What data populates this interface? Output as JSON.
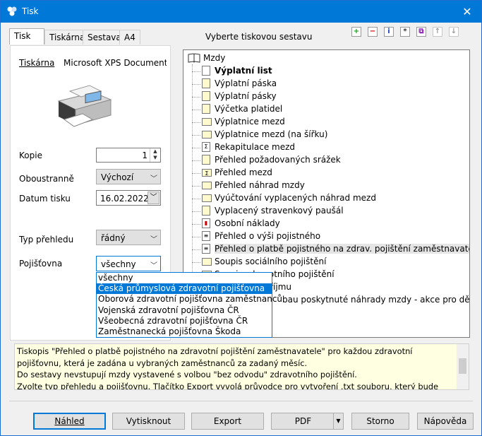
{
  "window": {
    "title": "Tisk",
    "close_icon": "✕"
  },
  "tabs": [
    {
      "label": "Tisk",
      "active": true
    },
    {
      "label": "Tiskárna"
    },
    {
      "label": "Sestava"
    },
    {
      "label": "A4"
    }
  ],
  "left": {
    "printer_label": "Tiskárna",
    "printer_name": "Microsoft XPS Document W",
    "copies_label": "Kopie",
    "copies_value": "1",
    "duplex_label": "Oboustranně",
    "duplex_value": "Výchozí",
    "date_label": "Datum tisku",
    "date_value": "16.02.2022",
    "type_label": "Typ přehledu",
    "type_value": "řádný",
    "insurer_label": "Pojišťovna",
    "insurer_value": "všechny",
    "insurer_options": [
      "všechny",
      "Česká průmyslová zdravotní pojišťovna",
      "Oborová zdravotní pojišťovna zaměstnanců bank, poj.",
      "Vojenská zdravotní pojišťovna ČR",
      "Všeobecná zdravotní pojišťovna ČR",
      "Zaměstnanecká pojišťovna Škoda"
    ]
  },
  "report": {
    "title": "Vyberte tiskovou sestavu",
    "root": "Mzdy",
    "items": [
      "Výplatní list",
      "Výplatní páska",
      "Výplatní pásky",
      "Výčetka platidel",
      "Výplatnice mezd",
      "Výplatnice mezd (na šířku)",
      "Rekapitulace mezd",
      "Přehled požadovaných srážek",
      "Přehled mezd",
      "Přehled náhrad mzdy",
      "Vyúčtování vyplacených náhrad mezd",
      "Vyplacený stravenkový paušál",
      "Osobní náklady",
      "Přehled o výši pojistného",
      "Přehled o platbě pojistného na zdrav. pojištění zaměstnavatele",
      "Soupis sociálního pojištění",
      "Soupis zdravotního pojištění",
      "Potvrzení o příjmu",
      "Přehled o výši pojistného - zaměstnanci, kteří mají nárok na poskytnuté náhrady mzdy - akce pro děti a mládež"
    ],
    "tail_items": [
      "Soupis zdravotního pojištění",
      "Potvrzení o příjmu",
      "bau poskytnuté náhrady mzdy - akce pro děti a mládež"
    ]
  },
  "description": "Tiskopis \"Přehled o platbě pojistného na zdravotní pojištění zaměstnavatele\" pro každou zdravotní pojišťovnu, která je zadána u vybraných zaměstnanců za zadaný měsíc.\nDo sestavy nevstupují mzdy vystavené s volbou \"bez odvodu\" zdravotního pojištění.\nZvolte typ přehledu a pojišťovnu. Tlačítko Export vyvolá průvodce pro vytvoření .txt souboru, který bude uložen do",
  "buttons": {
    "preview": "Náhled",
    "print": "Vytisknout",
    "export": "Export",
    "pdf": "PDF",
    "cancel": "Storno",
    "help": "Nápověda"
  }
}
